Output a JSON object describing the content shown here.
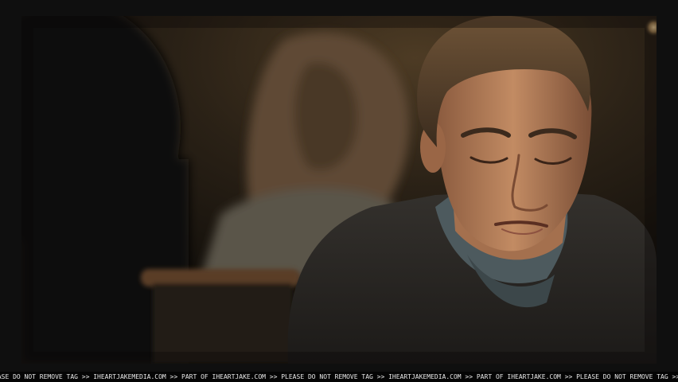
{
  "watermark": {
    "text": "EASE DO NOT REMOVE TAG >> IHEARTJAKEMEDIA.COM >> PART OF IHEARTJAKE.COM >> PLEASE DO NOT REMOVE TAG >> IHEARTJAKEMEDIA.COM >> PART OF IHEARTJAKE.COM >> PLEASE DO NOT REMOVE TAG >> IHEARTJAKEN"
  },
  "colors": {
    "background": "#0f0f0f",
    "scene_dark": "#15120c",
    "warm_light": "#d9b27a",
    "skin": "#b47a55",
    "sweater": "#2c2a27",
    "undershirt": "#4d5a5e",
    "hair": "#3b2a1d"
  }
}
